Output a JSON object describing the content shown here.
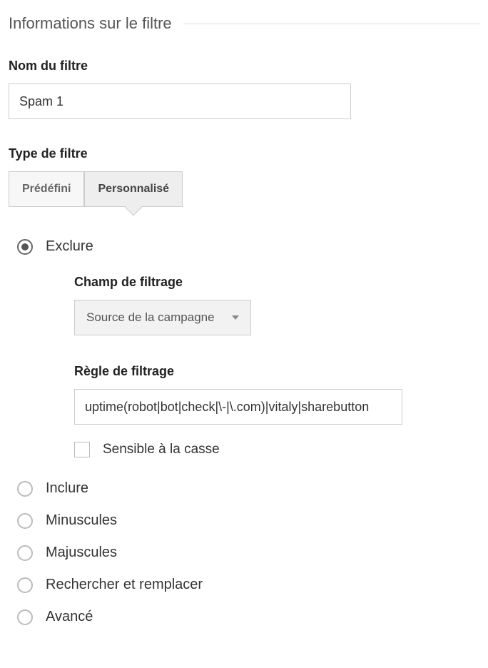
{
  "section": {
    "title": "Informations sur le filtre"
  },
  "filterName": {
    "label": "Nom du filtre",
    "value": "Spam 1"
  },
  "filterType": {
    "label": "Type de filtre",
    "tabs": {
      "predefined": "Prédéfini",
      "custom": "Personnalisé"
    }
  },
  "exclude": {
    "label": "Exclure",
    "filterField": {
      "label": "Champ de filtrage",
      "selected": "Source de la campagne"
    },
    "filterRule": {
      "label": "Règle de filtrage",
      "value": "uptime(robot|bot|check|\\-|\\.com)|vitaly|sharebutton"
    },
    "caseSensitive": {
      "label": "Sensible à la casse"
    }
  },
  "options": {
    "include": "Inclure",
    "lowercase": "Minuscules",
    "uppercase": "Majuscules",
    "searchReplace": "Rechercher et remplacer",
    "advanced": "Avancé"
  }
}
